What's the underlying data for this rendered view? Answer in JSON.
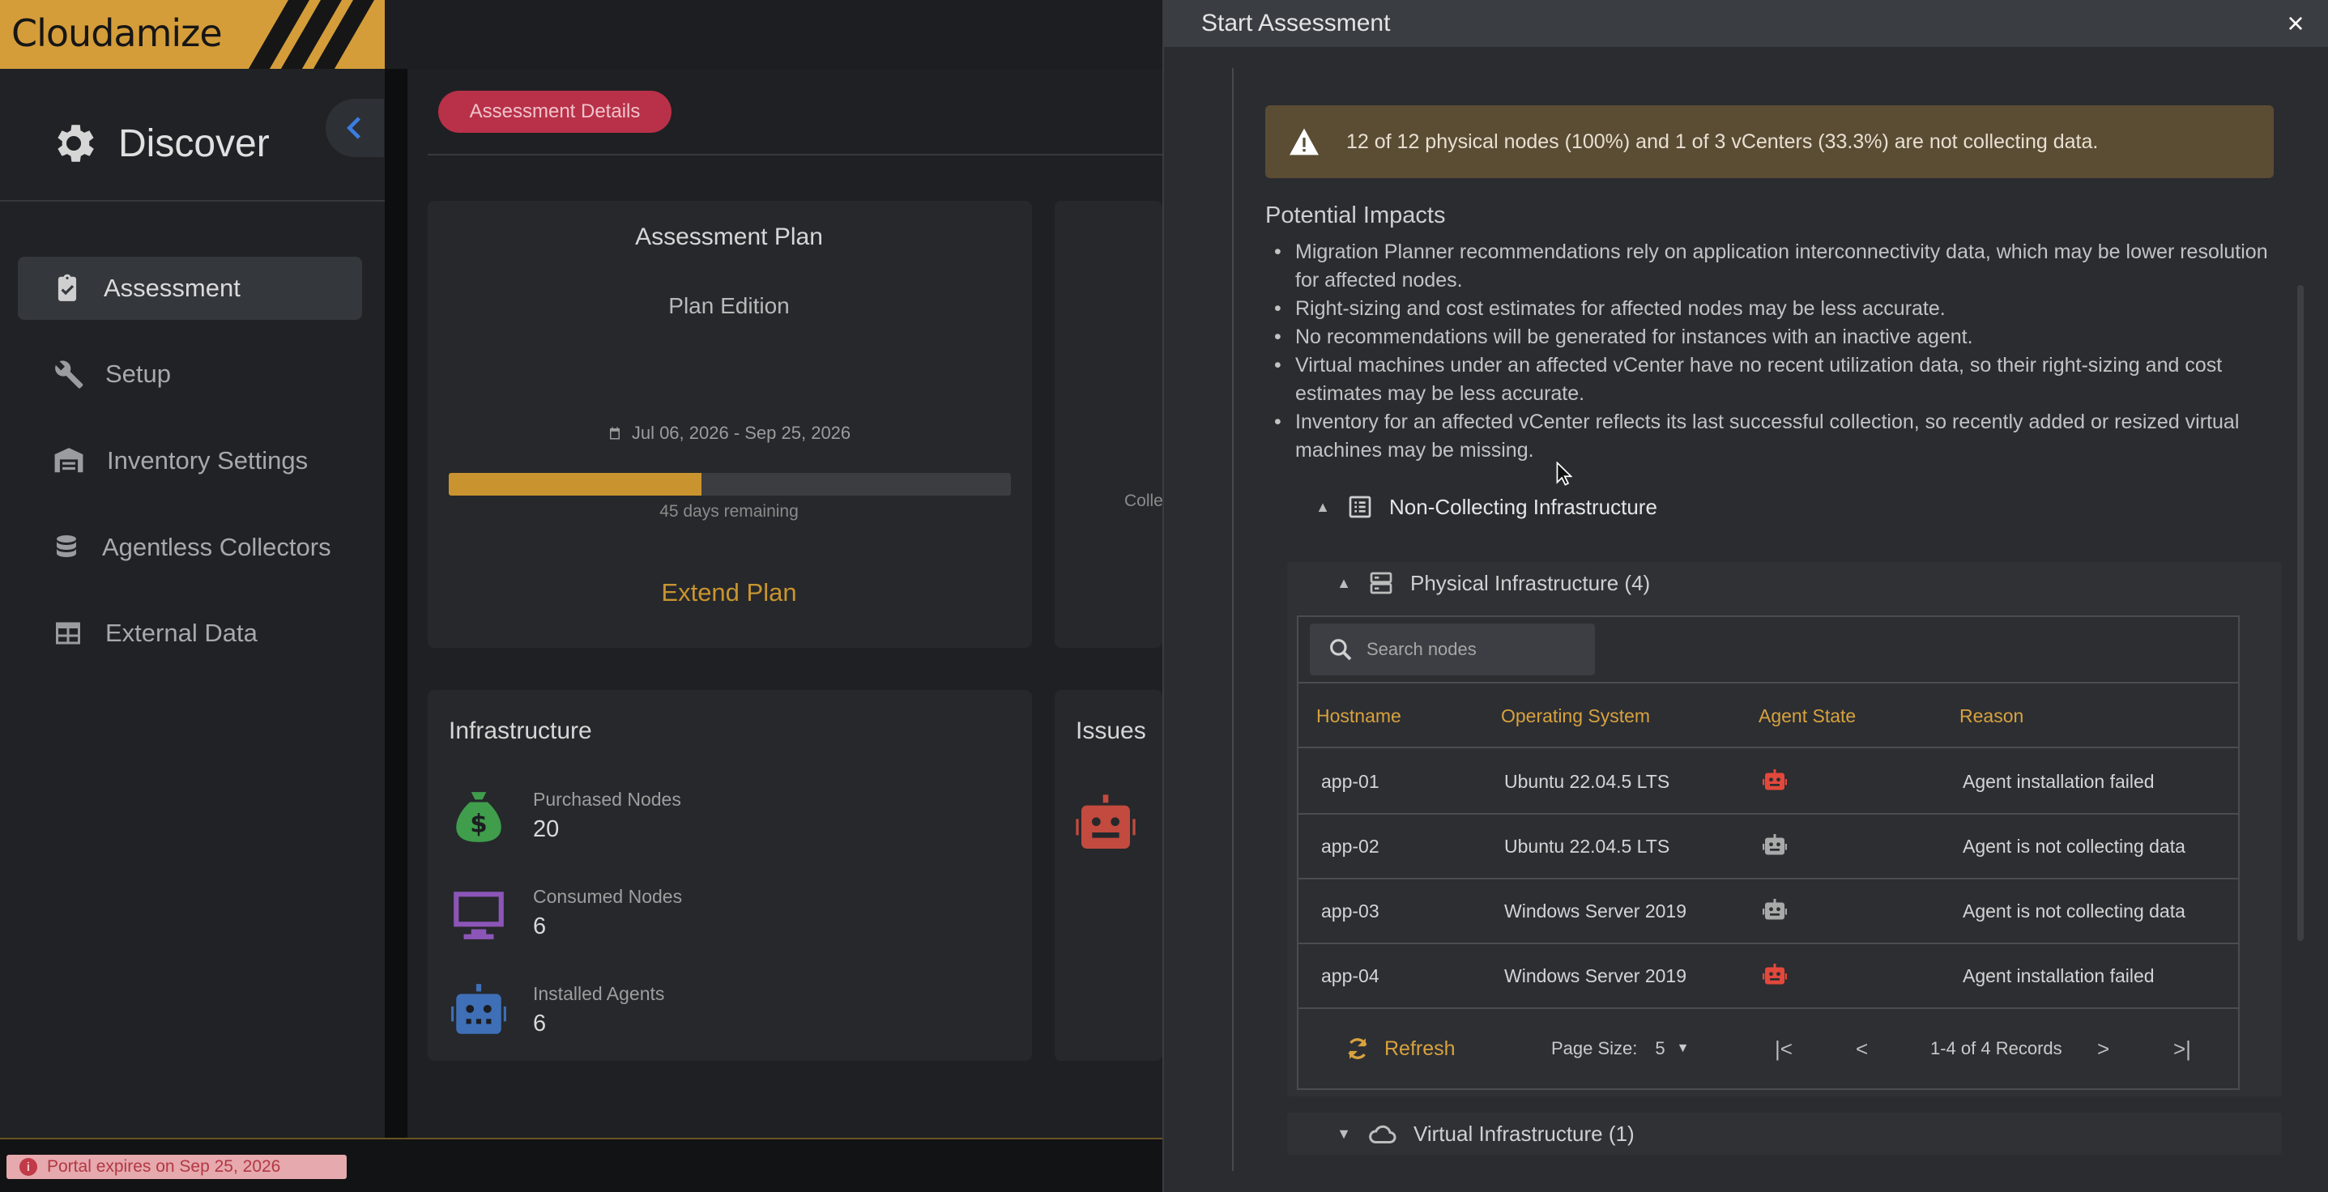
{
  "app": {
    "brand": "Cloudamize"
  },
  "sidebar": {
    "title": "Discover",
    "items": [
      {
        "label": "Assessment",
        "icon": "clipboard-check-icon",
        "active": true
      },
      {
        "label": "Setup",
        "icon": "tools-icon",
        "active": false
      },
      {
        "label": "Inventory Settings",
        "icon": "warehouse-icon",
        "active": false
      },
      {
        "label": "Agentless Collectors",
        "icon": "database-icon",
        "active": false
      },
      {
        "label": "External Data",
        "icon": "table-icon",
        "active": false
      }
    ]
  },
  "main": {
    "tab_label": "Assessment Details",
    "plan": {
      "title": "Assessment Plan",
      "edition": "Plan Edition",
      "dates": "Jul 06, 2026 - Sep 25, 2026",
      "progress_fraction": 0.45,
      "remaining": "45 days remaining",
      "extend_label": "Extend Plan"
    },
    "card2_partial": "Colle",
    "infrastructure": {
      "title": "Infrastructure",
      "stats": [
        {
          "label": "Purchased Nodes",
          "value": "20",
          "icon": "money-bag-icon",
          "color": "#3f9d4c"
        },
        {
          "label": "Consumed Nodes",
          "value": "6",
          "icon": "monitor-icon",
          "color": "#8c55b8"
        },
        {
          "label": "Installed Agents",
          "value": "6",
          "icon": "robot-icon",
          "color": "#3f6fb7"
        }
      ]
    },
    "issues": {
      "title": "Issues"
    }
  },
  "footer": {
    "portal_expiry": "Portal expires on Sep 25, 2026"
  },
  "modal": {
    "title": "Start Assessment",
    "close": "×",
    "warning": "12 of 12 physical nodes (100%) and 1 of 3 vCenters (33.3%) are not collecting data.",
    "impacts_title": "Potential Impacts",
    "impacts": [
      "Migration Planner recommendations rely on application interconnectivity data, which may be lower resolution for affected nodes.",
      "Right-sizing and cost estimates for affected nodes may be less accurate.",
      "No recommendations will be generated for instances with an inactive agent.",
      "Virtual machines under an affected vCenter have no recent utilization data, so their right-sizing and cost estimates may be less accurate.",
      "Inventory for an affected vCenter reflects its last successful collection, so recently added or resized virtual machines may be missing."
    ],
    "tree": {
      "non_collecting": "Non-Collecting Infrastructure",
      "physical": "Physical Infrastructure (4)",
      "virtual": "Virtual Infrastructure (1)"
    },
    "grid": {
      "search_placeholder": "Search nodes",
      "columns": [
        "Hostname",
        "Operating System",
        "Agent State",
        "Reason"
      ],
      "rows": [
        {
          "hostname": "app-01",
          "os": "Ubuntu 22.04.5 LTS",
          "agent_state": "failed",
          "agent_color": "#e2483b",
          "reason": "Agent installation failed"
        },
        {
          "hostname": "app-02",
          "os": "Ubuntu 22.04.5 LTS",
          "agent_state": "inactive",
          "agent_color": "#a9a9a9",
          "reason": "Agent is not collecting data"
        },
        {
          "hostname": "app-03",
          "os": "Windows Server 2019",
          "agent_state": "inactive",
          "agent_color": "#a9a9a9",
          "reason": "Agent is not collecting data"
        },
        {
          "hostname": "app-04",
          "os": "Windows Server 2019",
          "agent_state": "failed",
          "agent_color": "#e2483b",
          "reason": "Agent installation failed"
        }
      ],
      "refresh_label": "Refresh",
      "page_size_label": "Page Size:",
      "page_size_value": "5",
      "records": "1-4 of 4 Records"
    }
  },
  "colors": {
    "accent": "#d49d3a",
    "danger": "#b83148",
    "warning_bg": "#5b4c34"
  }
}
